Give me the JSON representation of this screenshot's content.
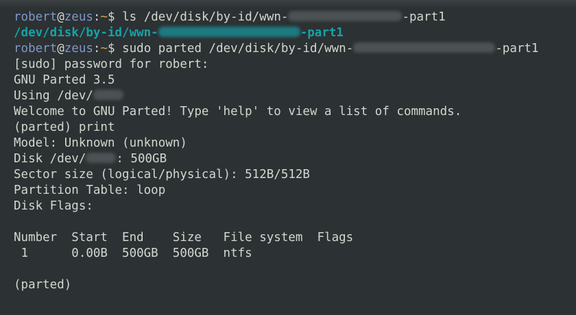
{
  "terminal": {
    "prompt": {
      "user": "robert",
      "at": "@",
      "host": "zeus",
      "colon": ":",
      "path": "~",
      "dollar": "$"
    },
    "line1": {
      "cmd": " ls /dev/disk/by-id/wwn-",
      "suffix": "-part1"
    },
    "line2": {
      "prefix": "/dev/disk/by-id/wwn-",
      "suffix": "-part1"
    },
    "line3": {
      "cmd": " sudo parted /dev/disk/by-id/wwn-",
      "suffix": "-part1"
    },
    "line4": "[sudo] password for robert:",
    "line5": "GNU Parted 3.5",
    "line6": {
      "prefix": "Using /dev/",
      "suffix": ""
    },
    "line7": "Welcome to GNU Parted! Type 'help' to view a list of commands.",
    "line8": "(parted) print",
    "line9": "Model: Unknown (unknown)",
    "line10": {
      "prefix": "Disk /dev/",
      "suffix": ": 500GB"
    },
    "line11": "Sector size (logical/physical): 512B/512B",
    "line12": "Partition Table: loop",
    "line13": "Disk Flags:",
    "table": {
      "header": "Number  Start  End    Size   File system  Flags",
      "row1": " 1      0.00B  500GB  500GB  ntfs"
    },
    "final_prompt": "(parted)"
  },
  "colors": {
    "background": "#2c3133",
    "prompt_user": "#8196c9",
    "prompt_path": "#d7a95f",
    "link": "#15a3a8",
    "text": "#d3d7cf"
  }
}
